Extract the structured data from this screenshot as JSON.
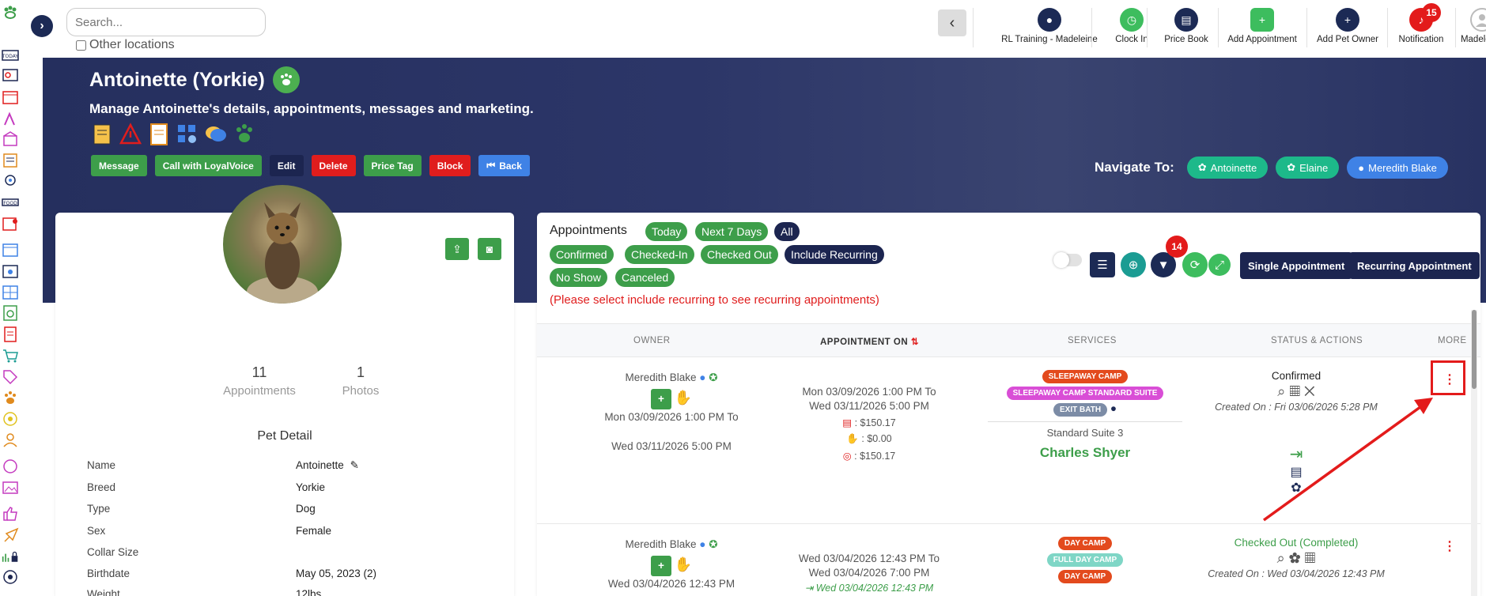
{
  "topbar": {
    "search_placeholder": "Search...",
    "other_locations_label": "Other locations",
    "items": [
      {
        "label": "RL Training - Madeleine",
        "icon": "location-pin-icon",
        "color": "#1c2a55"
      },
      {
        "label": "Clock In",
        "icon": "clock-icon",
        "color": "#3dbd5e"
      },
      {
        "label": "Price Book",
        "icon": "document-icon",
        "color": "#1c2a55"
      },
      {
        "label": "Add Appointment",
        "icon": "calendar-plus-icon",
        "color": "#3dbd5e"
      },
      {
        "label": "Add Pet Owner",
        "icon": "user-plus-icon",
        "color": "#1c2a55"
      },
      {
        "label": "Notification",
        "icon": "bell-icon",
        "color": "#e31b1b",
        "badge": "15"
      },
      {
        "label": "Madeleine",
        "icon": "user-avatar-icon",
        "color": "#bbbbbb"
      }
    ]
  },
  "hero": {
    "title": "Antoinette (Yorkie)",
    "subtitle": "Manage Antoinette's details, appointments, messages and marketing.",
    "buttons": {
      "message": "Message",
      "call": "Call with LoyalVoice",
      "edit": "Edit",
      "delete": "Delete",
      "price_tag": "Price Tag",
      "block": "Block",
      "back": "Back"
    },
    "navigate_to_label": "Navigate To:",
    "navigate_to": [
      "Antoinette",
      "Elaine",
      "Meredith Blake"
    ]
  },
  "pet_card": {
    "appointments_count": "11",
    "appointments_label": "Appointments",
    "photos_count": "1",
    "photos_label": "Photos",
    "detail_title": "Pet Detail",
    "details": [
      {
        "key": "Name",
        "value": "Antoinette"
      },
      {
        "key": "Breed",
        "value": "Yorkie"
      },
      {
        "key": "Type",
        "value": "Dog"
      },
      {
        "key": "Sex",
        "value": "Female"
      },
      {
        "key": "Collar Size",
        "value": ""
      },
      {
        "key": "Birthdate",
        "value": "May 05, 2023  (2)"
      },
      {
        "key": "Weight",
        "value": "12lbs"
      }
    ]
  },
  "appointments": {
    "title": "Appointments",
    "filters_row1": [
      "Today",
      "Next 7 Days",
      "All"
    ],
    "filters_row2": [
      "Confirmed",
      "Checked-In",
      "Checked Out",
      "Include Recurring"
    ],
    "filters_row3": [
      "No Show",
      "Canceled"
    ],
    "note": "(Please select include recurring to see recurring appointments)",
    "filter_badge": "14",
    "single_btn": "Single Appointment",
    "recurring_btn": "Recurring Appointment",
    "columns": {
      "owner": "OWNER",
      "appointment_on": "APPOINTMENT ON",
      "services": "SERVICES",
      "status": "STATUS & ACTIONS",
      "more": "MORE"
    },
    "rows": [
      {
        "owner": "Meredith Blake",
        "owner_range_start": "Mon 03/09/2026 1:00 PM To",
        "owner_range_end": "Wed 03/11/2026 5:00 PM",
        "appt_start": "Mon 03/09/2026 1:00 PM To",
        "appt_end": "Wed 03/11/2026 5:00 PM",
        "price_total": ": $150.17",
        "price_discount": ": $0.00",
        "price_due": ": $150.17",
        "services": [
          "SLEEPAWAY CAMP",
          "SLEEPAWAY CAMP STANDARD SUITE",
          "EXIT BATH"
        ],
        "suite": "Standard Suite 3",
        "staff": "Charles Shyer",
        "status": "Confirmed",
        "created_on": "Created On : Fri 03/06/2026 5:28 PM"
      },
      {
        "owner": "Meredith Blake",
        "owner_date": "Wed 03/04/2026 12:43 PM",
        "appt_start": "Wed 03/04/2026 12:43 PM To",
        "appt_end": "Wed 03/04/2026 7:00 PM",
        "checkin": "Wed 03/04/2026 12:43 PM",
        "services": [
          "DAY CAMP",
          "FULL DAY CAMP",
          "DAY CAMP"
        ],
        "status": "Checked Out (Completed)",
        "created_on": "Created On : Wed 03/04/2026 12:43 PM"
      }
    ]
  },
  "colors": {
    "navy": "#1c2550",
    "green": "#3d9e4a",
    "red": "#e01d1d",
    "blue": "#3f82e6",
    "teal": "#1db98a"
  }
}
